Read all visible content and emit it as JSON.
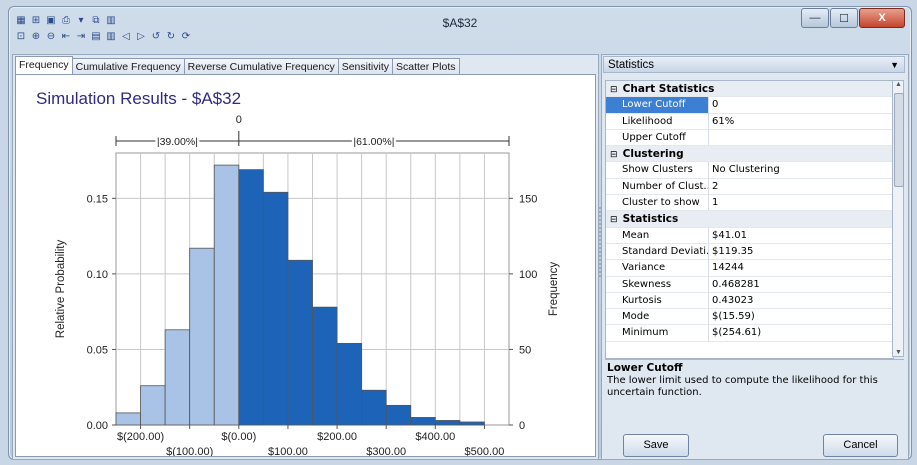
{
  "window": {
    "title": "$A$32",
    "min_glyph": "—",
    "max_glyph": "☐",
    "close_glyph": "X"
  },
  "toolbar": {
    "row1": [
      {
        "icon": "app-icon",
        "glyph": "▦"
      },
      {
        "icon": "open-icon",
        "glyph": "⊞"
      },
      {
        "icon": "save-icon",
        "glyph": "▣"
      },
      {
        "icon": "print-icon",
        "glyph": "⎙"
      },
      {
        "icon": "dropdown-arrow-icon",
        "glyph": "▾"
      },
      {
        "icon": "copy-icon",
        "glyph": "⧉"
      },
      {
        "icon": "chart-icon",
        "glyph": "▥"
      }
    ],
    "row2": [
      {
        "icon": "fit-icon",
        "glyph": "⊡"
      },
      {
        "icon": "zoom-in-icon",
        "glyph": "⊕"
      },
      {
        "icon": "zoom-out-icon",
        "glyph": "⊖"
      },
      {
        "icon": "bin-decrease-icon",
        "glyph": "⇤"
      },
      {
        "icon": "bin-increase-icon",
        "glyph": "⇥"
      },
      {
        "icon": "bar-chart-icon",
        "glyph": "▤"
      },
      {
        "icon": "bar-chart-2-icon",
        "glyph": "▥"
      },
      {
        "icon": "move-left-icon",
        "glyph": "◁"
      },
      {
        "icon": "move-right-icon",
        "glyph": "▷"
      },
      {
        "icon": "rotate-left-icon",
        "glyph": "↺"
      },
      {
        "icon": "rotate-right-icon",
        "glyph": "↻"
      },
      {
        "icon": "refresh-icon",
        "glyph": "⟳"
      }
    ]
  },
  "tabs": [
    {
      "label": "Frequency",
      "active": true
    },
    {
      "label": "Cumulative Frequency",
      "active": false
    },
    {
      "label": "Reverse Cumulative Frequency",
      "active": false
    },
    {
      "label": "Sensitivity",
      "active": false
    },
    {
      "label": "Scatter Plots",
      "active": false
    }
  ],
  "chart_data": {
    "type": "bar",
    "title": "Simulation Results - $A$32",
    "ylabel": "Relative Probability",
    "y2label": "Frequency",
    "xlim": [
      -250,
      550
    ],
    "ylim": [
      0,
      0.18
    ],
    "y2lim": [
      0,
      180
    ],
    "yticks": [
      {
        "v": 0,
        "label": "0.00"
      },
      {
        "v": 0.05,
        "label": "0.05"
      },
      {
        "v": 0.1,
        "label": "0.10"
      },
      {
        "v": 0.15,
        "label": "0.15"
      }
    ],
    "y2ticks": [
      {
        "v": 0,
        "label": "0"
      },
      {
        "v": 50,
        "label": "50"
      },
      {
        "v": 100,
        "label": "100"
      },
      {
        "v": 150,
        "label": "150"
      }
    ],
    "xticks_upper": [
      {
        "v": -200,
        "label": "$(200.00)"
      },
      {
        "v": 0,
        "label": "$(0.00)"
      },
      {
        "v": 200,
        "label": "$200.00"
      },
      {
        "v": 400,
        "label": "$400.00"
      }
    ],
    "xticks_lower": [
      {
        "v": -100,
        "label": "$(100.00)"
      },
      {
        "v": 100,
        "label": "$100.00"
      },
      {
        "v": 300,
        "label": "$300.00"
      },
      {
        "v": 500,
        "label": "$500.00"
      }
    ],
    "grid": true,
    "bin_width": 50,
    "bins": [
      {
        "x0": -250,
        "p": 0.008
      },
      {
        "x0": -200,
        "p": 0.026
      },
      {
        "x0": -150,
        "p": 0.063
      },
      {
        "x0": -100,
        "p": 0.117
      },
      {
        "x0": -50,
        "p": 0.172
      },
      {
        "x0": 0,
        "p": 0.169
      },
      {
        "x0": 50,
        "p": 0.154
      },
      {
        "x0": 100,
        "p": 0.109
      },
      {
        "x0": 150,
        "p": 0.078
      },
      {
        "x0": 200,
        "p": 0.054
      },
      {
        "x0": 250,
        "p": 0.023
      },
      {
        "x0": 300,
        "p": 0.013
      },
      {
        "x0": 350,
        "p": 0.005
      },
      {
        "x0": 400,
        "p": 0.003
      },
      {
        "x0": 450,
        "p": 0.002
      }
    ],
    "cutoff": {
      "value": 0,
      "label": "0"
    },
    "left_pct": "39.00%",
    "right_pct": "61.00%",
    "colors": {
      "lower": "#a9c3e6",
      "upper": "#1d63b8",
      "border": "#555555"
    }
  },
  "stats_panel": {
    "header": "Statistics",
    "categories": [
      {
        "title": "Chart Statistics",
        "rows": [
          {
            "name": "Lower Cutoff",
            "value": "0",
            "selected": true
          },
          {
            "name": "Likelihood",
            "value": "61%"
          },
          {
            "name": "Upper Cutoff",
            "value": ""
          }
        ]
      },
      {
        "title": "Clustering",
        "rows": [
          {
            "name": "Show Clusters",
            "value": "No Clustering"
          },
          {
            "name": "Number of Clust...",
            "value": "2"
          },
          {
            "name": "Cluster to show",
            "value": "1"
          }
        ]
      },
      {
        "title": "Statistics",
        "rows": [
          {
            "name": "Mean",
            "value": " $41.01"
          },
          {
            "name": "Standard Deviati...",
            "value": " $119.35"
          },
          {
            "name": "Variance",
            "value": " 14244"
          },
          {
            "name": "Skewness",
            "value": " 0.468281"
          },
          {
            "name": "Kurtosis",
            "value": " 0.43023"
          },
          {
            "name": "Mode",
            "value": " $(15.59)"
          },
          {
            "name": "Minimum",
            "value": " $(254.61)"
          }
        ]
      }
    ],
    "expander_glyph": "⊟",
    "description": {
      "title": "Lower Cutoff",
      "text": "The lower limit used to compute the likelihood for this uncertain function."
    },
    "save_label": "Save",
    "cancel_label": "Cancel"
  }
}
